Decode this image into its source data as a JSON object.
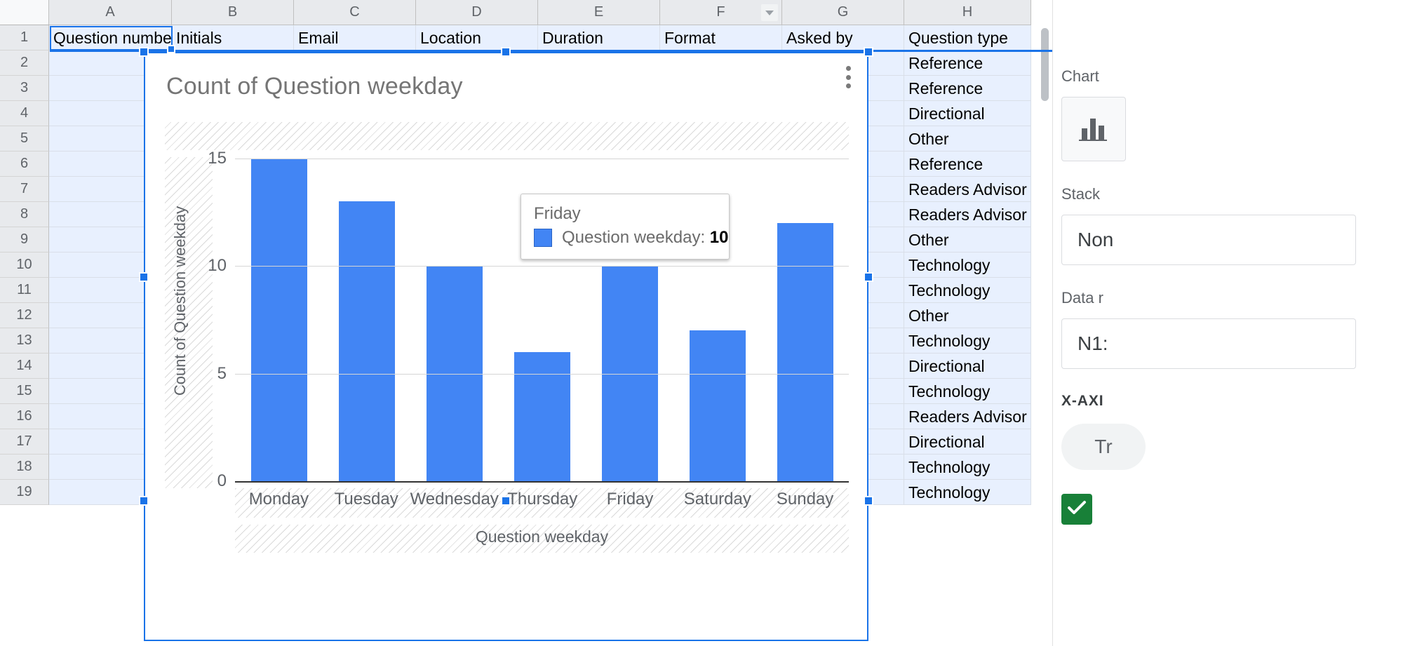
{
  "spreadsheet": {
    "column_headers": [
      "A",
      "B",
      "C",
      "D",
      "E",
      "F",
      "G",
      "H"
    ],
    "filter_column": "F",
    "row_numbers": [
      "1",
      "2",
      "3",
      "4",
      "5",
      "6",
      "7",
      "8",
      "9",
      "10",
      "11",
      "12",
      "13",
      "14",
      "15",
      "16",
      "17",
      "18",
      "19"
    ],
    "header_row": [
      "Question number",
      "Initials",
      "Email",
      "Location",
      "Duration",
      "Format",
      "Asked by",
      "Question type"
    ],
    "question_type_column": [
      "Reference",
      "Reference",
      "Directional",
      "Other",
      "Reference",
      "Readers Advisor",
      "Readers Advisor",
      "Other",
      "Technology",
      "Technology",
      "Other",
      "Technology",
      "Directional",
      "Technology",
      "Readers Advisor",
      "Directional",
      "Technology",
      "Technology"
    ]
  },
  "chart_data": {
    "type": "bar",
    "title": "Count of Question weekday",
    "xlabel": "Question weekday",
    "ylabel": "Count of Question weekday",
    "categories": [
      "Monday",
      "Tuesday",
      "Wednesday",
      "Thursday",
      "Friday",
      "Saturday",
      "Sunday"
    ],
    "values": [
      15,
      13,
      10,
      6,
      10,
      7,
      12
    ],
    "yticks": [
      "15",
      "10",
      "5",
      "0"
    ],
    "ytick_values": [
      15,
      10,
      5,
      0
    ],
    "ylim": [
      0,
      15
    ],
    "grid": true,
    "legend": "none",
    "series_name": "Question weekday",
    "bar_color": "#4285f4"
  },
  "tooltip": {
    "category": "Friday",
    "series_label": "Question weekday",
    "separator": ": ",
    "value": "10"
  },
  "chart_editor": {
    "chart_type_label": "Chart",
    "chart_type_icon": "bar-chart-icon",
    "stacking_label": "Stack",
    "stacking_value": "Non",
    "data_range_label": "Data r",
    "data_range_value": "N1:",
    "x_axis_heading": "X-AXI",
    "x_axis_chip": "Tr",
    "checkbox_state": "checked"
  },
  "icons": {
    "filter": "filter-dropdown-icon",
    "overflow_menu": "three-dot-menu-icon",
    "checkmark": "check-icon"
  },
  "colors": {
    "accent": "#1a73e8",
    "bar": "#4285f4",
    "selection_fill": "#e8f0fe",
    "check_green": "#188038"
  }
}
